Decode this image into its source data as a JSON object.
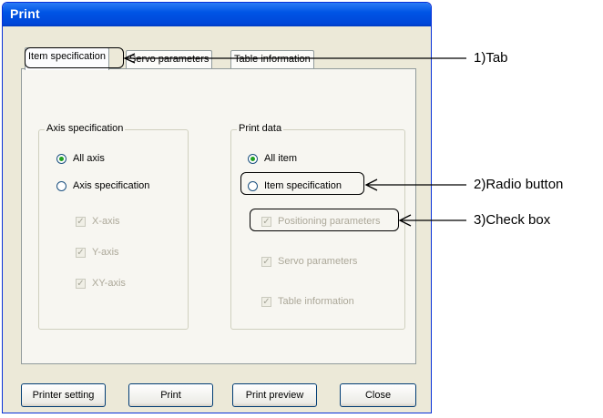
{
  "dialog": {
    "title": "Print",
    "tabs": [
      "Item specification",
      "Servo parameters",
      "Table information"
    ],
    "axis_group": {
      "legend": "Axis specification",
      "radio_all": "All axis",
      "radio_spec": "Axis specification",
      "checks": [
        "X-axis",
        "Y-axis",
        "XY-axis"
      ]
    },
    "print_group": {
      "legend": "Print data",
      "radio_all": "All item",
      "radio_spec": "Item specification",
      "checks": [
        "Positioning parameters",
        "Servo parameters",
        "Table information"
      ]
    },
    "buttons": {
      "printer_setting": "Printer setting",
      "print": "Print",
      "print_preview": "Print preview",
      "close": "Close"
    }
  },
  "annotations": {
    "tab": "1)Tab",
    "radio_button": "2)Radio button",
    "check_box": "3)Check box"
  },
  "colors": {
    "title_bar": "#0055e5",
    "radio_dot": "#21a121"
  }
}
